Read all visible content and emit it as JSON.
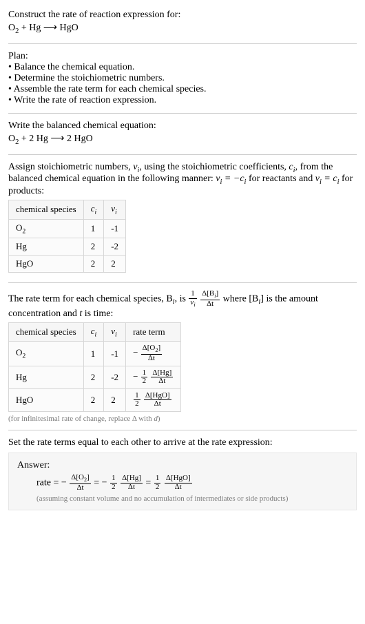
{
  "intro": {
    "title": "Construct the rate of reaction expression for:",
    "equation": "O₂ + Hg ⟶ HgO"
  },
  "plan": {
    "heading": "Plan:",
    "items": [
      "• Balance the chemical equation.",
      "• Determine the stoichiometric numbers.",
      "• Assemble the rate term for each chemical species.",
      "• Write the rate of reaction expression."
    ]
  },
  "balanced": {
    "heading": "Write the balanced chemical equation:",
    "equation": "O₂ + 2 Hg ⟶ 2 HgO"
  },
  "stoich_text": {
    "pre": "Assign stoichiometric numbers, ",
    "nu": "ν",
    "sub_i": "i",
    "mid1": ", using the stoichiometric coefficients, ",
    "c": "c",
    "mid2": ", from the balanced chemical equation in the following manner: ",
    "rel1": "νᵢ = −cᵢ",
    "mid3": " for reactants and ",
    "rel2": "νᵢ = cᵢ",
    "mid4": " for products:"
  },
  "table1": {
    "headers": [
      "chemical species",
      "cᵢ",
      "νᵢ"
    ],
    "rows": [
      [
        "O₂",
        "1",
        "-1"
      ],
      [
        "Hg",
        "2",
        "-2"
      ],
      [
        "HgO",
        "2",
        "2"
      ]
    ]
  },
  "rate_text": {
    "pre": "The rate term for each chemical species, B",
    "sub_i": "i",
    "mid1": ", is ",
    "frac1_num": "1",
    "frac1_den": "νᵢ",
    "frac2_num": "Δ[Bᵢ]",
    "frac2_den": "Δt",
    "mid2": " where [B",
    "mid3": "] is the amount concentration and ",
    "t": "t",
    "mid4": " is time:"
  },
  "table2": {
    "headers": [
      "chemical species",
      "cᵢ",
      "νᵢ",
      "rate term"
    ],
    "rows": [
      {
        "species": "O₂",
        "c": "1",
        "nu": "-1",
        "sign": "−",
        "coef_num": "",
        "coef_den": "",
        "dnum": "Δ[O₂]",
        "dden": "Δt"
      },
      {
        "species": "Hg",
        "c": "2",
        "nu": "-2",
        "sign": "−",
        "coef_num": "1",
        "coef_den": "2",
        "dnum": "Δ[Hg]",
        "dden": "Δt"
      },
      {
        "species": "HgO",
        "c": "2",
        "nu": "2",
        "sign": "",
        "coef_num": "1",
        "coef_den": "2",
        "dnum": "Δ[HgO]",
        "dden": "Δt"
      }
    ],
    "note": "(for infinitesimal rate of change, replace Δ with d)"
  },
  "final": {
    "heading": "Set the rate terms equal to each other to arrive at the rate expression:",
    "answer_label": "Answer:",
    "rate_word": "rate = ",
    "terms": [
      {
        "sign": "−",
        "coef_num": "",
        "coef_den": "",
        "dnum": "Δ[O₂]",
        "dden": "Δt"
      },
      {
        "sign": "−",
        "coef_num": "1",
        "coef_den": "2",
        "dnum": "Δ[Hg]",
        "dden": "Δt"
      },
      {
        "sign": "",
        "coef_num": "1",
        "coef_den": "2",
        "dnum": "Δ[HgO]",
        "dden": "Δt"
      }
    ],
    "eq": " = ",
    "note": "(assuming constant volume and no accumulation of intermediates or side products)"
  },
  "chart_data": {
    "type": "table",
    "tables": [
      {
        "title": "Stoichiometric numbers",
        "columns": [
          "chemical species",
          "c_i",
          "nu_i"
        ],
        "rows": [
          {
            "chemical species": "O2",
            "c_i": 1,
            "nu_i": -1
          },
          {
            "chemical species": "Hg",
            "c_i": 2,
            "nu_i": -2
          },
          {
            "chemical species": "HgO",
            "c_i": 2,
            "nu_i": 2
          }
        ]
      },
      {
        "title": "Rate terms",
        "columns": [
          "chemical species",
          "c_i",
          "nu_i",
          "rate term"
        ],
        "rows": [
          {
            "chemical species": "O2",
            "c_i": 1,
            "nu_i": -1,
            "rate term": "-(Δ[O2]/Δt)"
          },
          {
            "chemical species": "Hg",
            "c_i": 2,
            "nu_i": -2,
            "rate term": "-(1/2)(Δ[Hg]/Δt)"
          },
          {
            "chemical species": "HgO",
            "c_i": 2,
            "nu_i": 2,
            "rate term": "(1/2)(Δ[HgO]/Δt)"
          }
        ]
      }
    ],
    "rate_expression": "rate = -(Δ[O2]/Δt) = -(1/2)(Δ[Hg]/Δt) = (1/2)(Δ[HgO]/Δt)"
  }
}
